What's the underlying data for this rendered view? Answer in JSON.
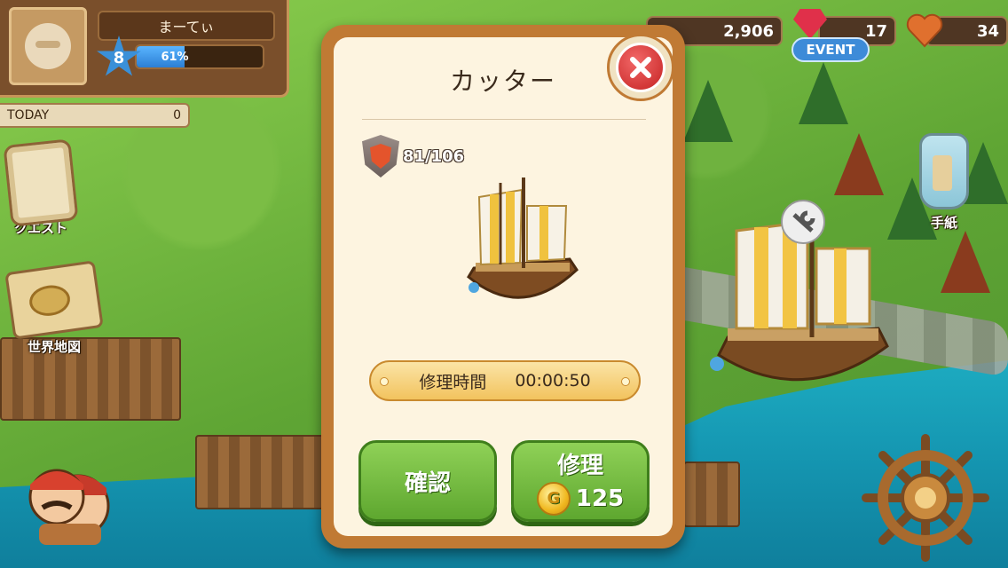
{
  "player": {
    "name": "まーてぃ",
    "level": "8",
    "xp_percent": 61,
    "xp_label": "61%",
    "today_label": "TODAY",
    "today_value": "0"
  },
  "resources": {
    "gold": "2,906",
    "ruby": "17",
    "hearts": "34",
    "event_label": "EVENT"
  },
  "side_menu": {
    "quest_label": "クエスト",
    "world_map_label": "世界地図",
    "letter_label": "手紙"
  },
  "dialog": {
    "title": "カッター",
    "hp": "81/106",
    "repair_time_label": "修理時間",
    "repair_time_value": "00:00:50",
    "confirm_label": "確認",
    "repair_label": "修理",
    "repair_cost": "125",
    "coin_symbol": "G"
  },
  "colors": {
    "dialog_border": "#c07a34",
    "dialog_bg": "#fdf4e0",
    "button_green": "#6fb83a",
    "close_red": "#d43030",
    "xp_blue": "#3a90d8"
  },
  "icons": [
    "close-icon",
    "shield-icon",
    "coin-icon",
    "heart-icon",
    "ruby-icon",
    "scroll-icon",
    "map-icon",
    "bottle-icon",
    "ship-wheel-icon",
    "crew-icon",
    "wrench-icon"
  ]
}
